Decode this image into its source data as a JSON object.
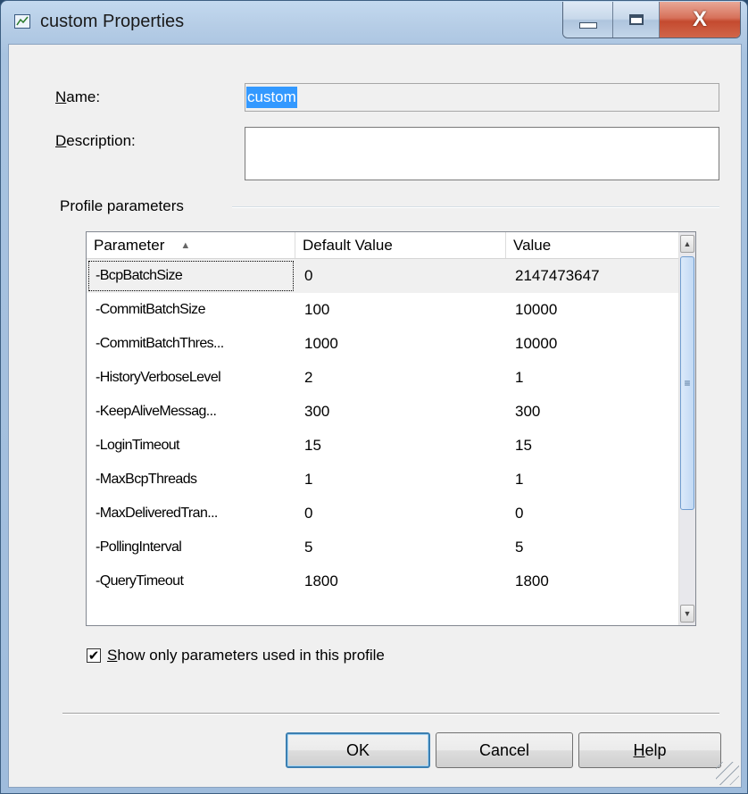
{
  "window": {
    "title": "custom Properties",
    "icon": "properties-window-icon",
    "caption_buttons": [
      "minimize-icon",
      "maximize-icon",
      "close-icon"
    ],
    "close_glyph": "X"
  },
  "form": {
    "name_label_mnemonic": "N",
    "name_label_rest": "ame:",
    "name_value": "custom",
    "description_label_mnemonic": "D",
    "description_label_rest": "escription:",
    "description_value": "",
    "group_title": "Profile parameters"
  },
  "table": {
    "columns": [
      "Parameter",
      "Default Value",
      "Value"
    ],
    "sort_column": "Parameter",
    "sort_direction": "ascending",
    "rows": [
      {
        "parameter": "-BcpBatchSize",
        "default_value": "0",
        "value": "2147473647"
      },
      {
        "parameter": "-CommitBatchSize",
        "default_value": "100",
        "value": "10000"
      },
      {
        "parameter": "-CommitBatchThres...",
        "default_value": "1000",
        "value": "10000"
      },
      {
        "parameter": "-HistoryVerboseLevel",
        "default_value": "2",
        "value": "1"
      },
      {
        "parameter": "-KeepAliveMessag...",
        "default_value": "300",
        "value": "300"
      },
      {
        "parameter": "-LoginTimeout",
        "default_value": "15",
        "value": "15"
      },
      {
        "parameter": "-MaxBcpThreads",
        "default_value": "1",
        "value": "1"
      },
      {
        "parameter": "-MaxDeliveredTran...",
        "default_value": "0",
        "value": "0"
      },
      {
        "parameter": "-PollingInterval",
        "default_value": "5",
        "value": "5"
      },
      {
        "parameter": "-QueryTimeout",
        "default_value": "1800",
        "value": "1800"
      }
    ],
    "selected_row": 0
  },
  "checkbox": {
    "checked": true,
    "mnemonic": "S",
    "label_rest": "how only parameters used in this profile"
  },
  "buttons": {
    "ok": "OK",
    "cancel": "Cancel",
    "help_mnemonic": "H",
    "help_rest": "elp"
  },
  "colors": {
    "selection": "#3399ff",
    "title_gradient": "#b6cde6",
    "close_button": "#c44a2f",
    "default_button_border": "#3c7fb1"
  }
}
